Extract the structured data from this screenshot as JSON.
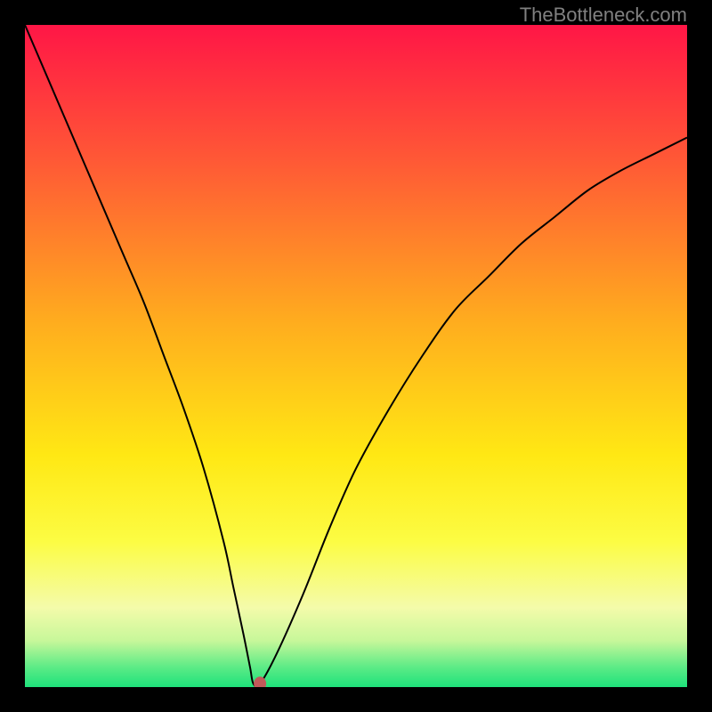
{
  "attribution": "TheBottleneck.com",
  "chart_data": {
    "type": "line",
    "title": "",
    "xlabel": "",
    "ylabel": "",
    "xlim": [
      0,
      100
    ],
    "ylim": [
      0,
      100
    ],
    "grid": false,
    "legend": false,
    "background": "rainbow-vertical-gradient",
    "gradient_stops": [
      {
        "offset": 0.0,
        "color": "#ff1646"
      },
      {
        "offset": 0.2,
        "color": "#ff5736"
      },
      {
        "offset": 0.45,
        "color": "#ffad1e"
      },
      {
        "offset": 0.65,
        "color": "#ffe814"
      },
      {
        "offset": 0.78,
        "color": "#fcfc43"
      },
      {
        "offset": 0.88,
        "color": "#f4fbaa"
      },
      {
        "offset": 0.93,
        "color": "#c7f79a"
      },
      {
        "offset": 0.97,
        "color": "#5ceb86"
      },
      {
        "offset": 1.0,
        "color": "#1ee27b"
      }
    ],
    "series": [
      {
        "name": "bottleneck-curve",
        "x": [
          0,
          3,
          6,
          9,
          12,
          15,
          18,
          21,
          24,
          27,
          30,
          31.5,
          33,
          34,
          34.5,
          35.5,
          38,
          42,
          46,
          50,
          55,
          60,
          65,
          70,
          75,
          80,
          85,
          90,
          95,
          100
        ],
        "y": [
          100,
          93,
          86,
          79,
          72,
          65,
          58,
          50,
          42,
          33,
          22,
          15,
          8,
          3,
          0.5,
          0.5,
          5,
          14,
          24,
          33,
          42,
          50,
          57,
          62,
          67,
          71,
          75,
          78,
          80.5,
          83
        ]
      }
    ],
    "marker": {
      "x": 35.5,
      "y": 0.5,
      "color": "#c1595a",
      "radius_px": 7
    }
  }
}
